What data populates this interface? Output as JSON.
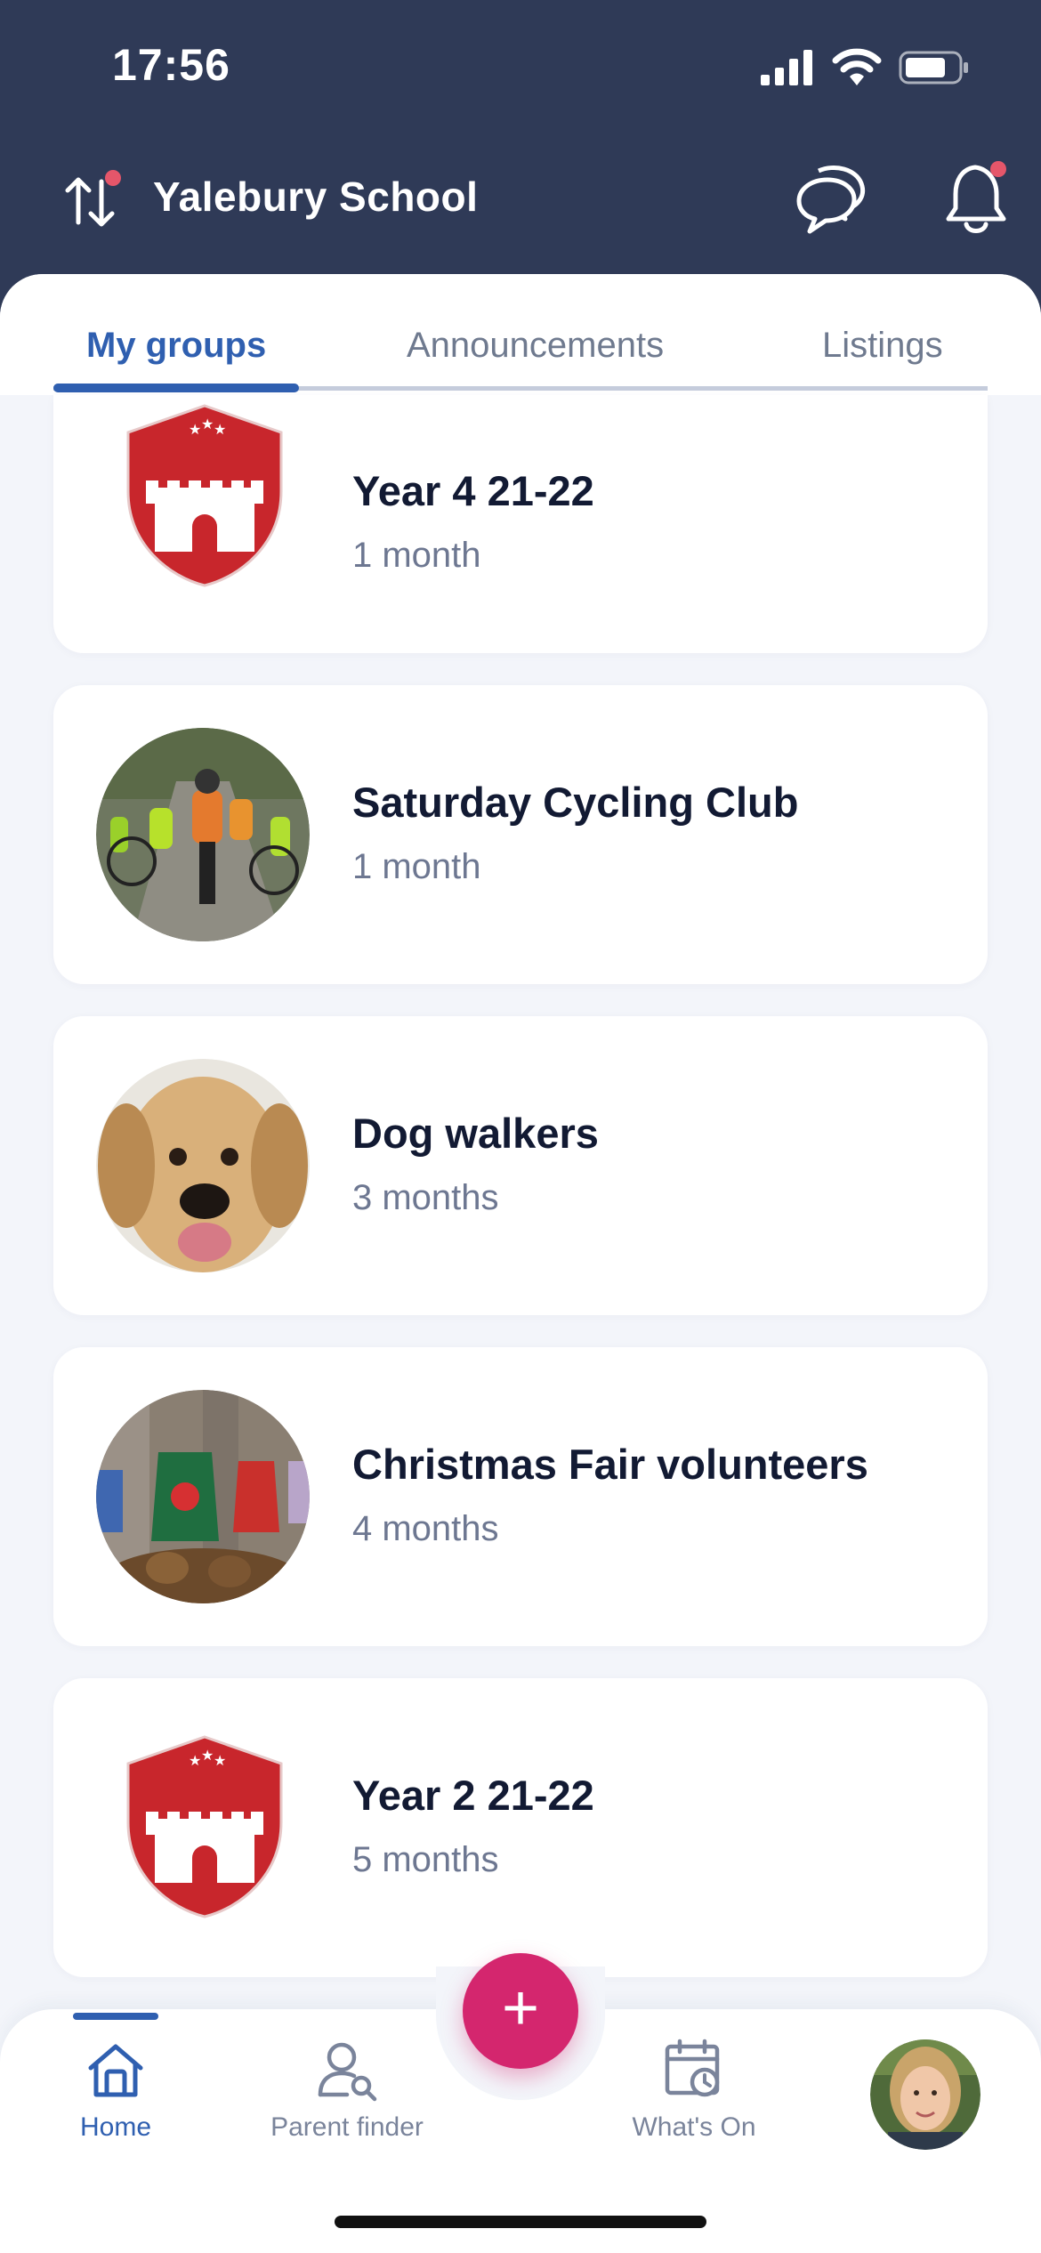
{
  "status": {
    "time": "17:56"
  },
  "header": {
    "school_name": "Yalebury School"
  },
  "tabs": [
    {
      "label": "My groups",
      "active": true
    },
    {
      "label": "Announcements",
      "active": false
    },
    {
      "label": "Listings",
      "active": false
    }
  ],
  "groups": [
    {
      "name": "Year 4 21-22",
      "time": "1 month",
      "avatar": "school-crest"
    },
    {
      "name": "Saturday Cycling Club",
      "time": "1 month",
      "avatar": "cycling-photo"
    },
    {
      "name": "Dog walkers",
      "time": "3 months",
      "avatar": "puppy-photo"
    },
    {
      "name": "Christmas Fair volunteers",
      "time": "4 months",
      "avatar": "christmas-photo"
    },
    {
      "name": "Year 2 21-22",
      "time": "5 months",
      "avatar": "school-crest"
    }
  ],
  "fab": {
    "label": "+"
  },
  "nav": {
    "home": "Home",
    "parent_finder": "Parent finder",
    "whats_on": "What's On"
  },
  "colors": {
    "header_bg": "#2f3a57",
    "accent": "#2f5fb0",
    "fab": "#d4266e",
    "notification_dot": "#e5566a"
  }
}
